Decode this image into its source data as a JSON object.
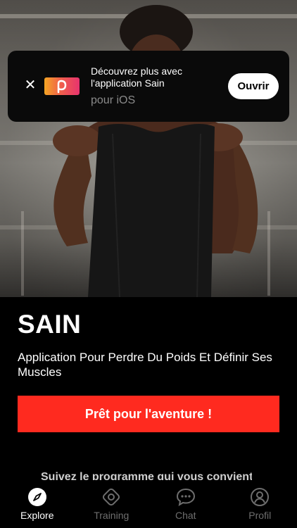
{
  "banner": {
    "title": "Découvrez plus avec l'application Sain",
    "subtitle": "pour iOS",
    "open_label": "Ouvrir",
    "close_symbol": "✕",
    "app_icon": "sain-app-icon"
  },
  "main": {
    "app_name": "SAIN",
    "tagline": "Application Pour Perdre Du Poids Et Définir Ses Muscles",
    "cta_label": "Prêt pour l'aventure !",
    "cta_color": "#ff2a1f",
    "cutoff_text": "Suivez le programme qui vous convient"
  },
  "tabbar": {
    "tabs": [
      {
        "label": "Explore",
        "icon": "compass-icon",
        "active": true
      },
      {
        "label": "Training",
        "icon": "training-icon",
        "active": false
      },
      {
        "label": "Chat",
        "icon": "chat-icon",
        "active": false
      },
      {
        "label": "Profil",
        "icon": "profile-icon",
        "active": false
      }
    ]
  }
}
